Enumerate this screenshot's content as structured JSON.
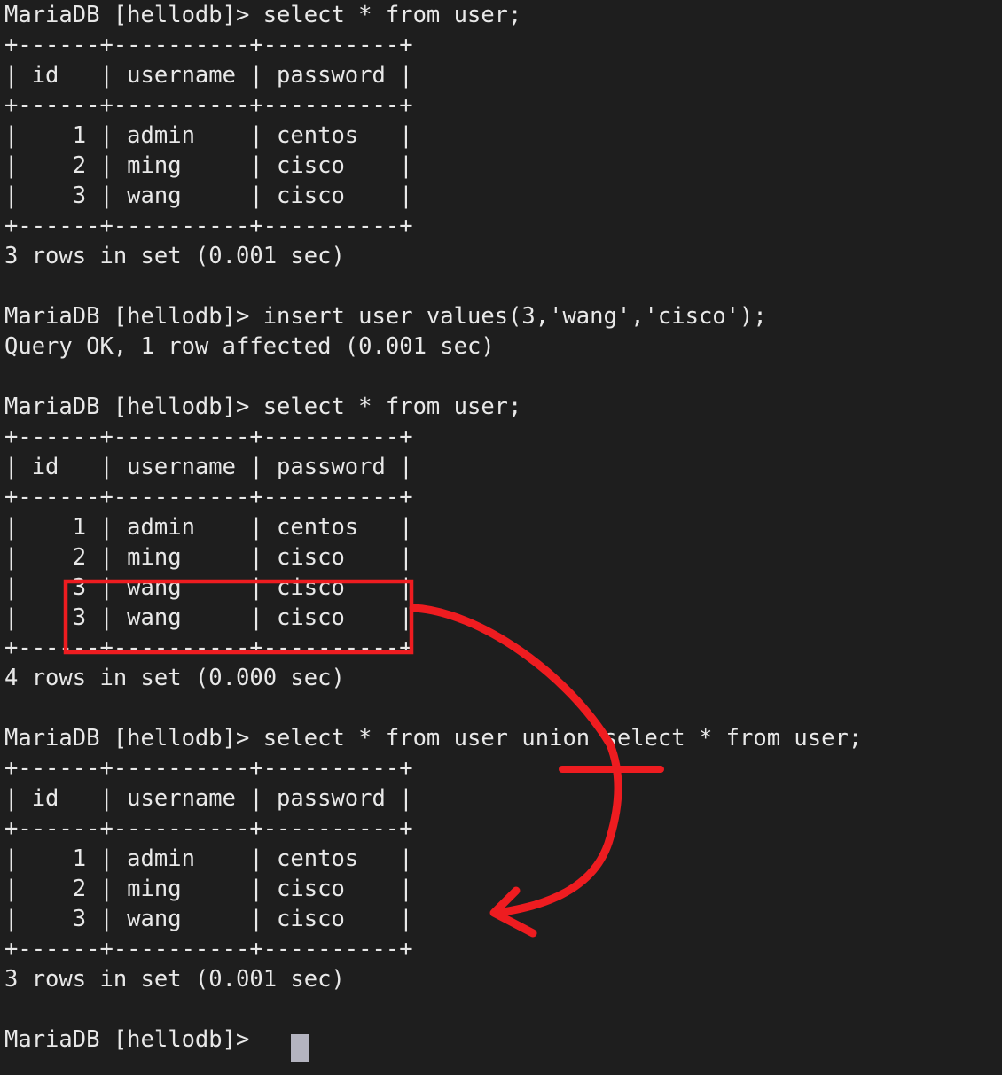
{
  "terminal": {
    "background_color": "#1e1e1e",
    "text_color": "#e8e8e8",
    "annotation_color": "#ee1c20",
    "cursor_color": "#b4b4c0",
    "prompt": "MariaDB [hellodb]>",
    "session_text": "MariaDB [hellodb]> select * from user;\n+------+----------+----------+\n| id   | username | password |\n+------+----------+----------+\n|    1 | admin    | centos   |\n|    2 | ming     | cisco    |\n|    3 | wang     | cisco    |\n+------+----------+----------+\n3 rows in set (0.001 sec)\n\nMariaDB [hellodb]> insert user values(3,'wang','cisco');\nQuery OK, 1 row affected (0.001 sec)\n\nMariaDB [hellodb]> select * from user;\n+------+----------+----------+\n| id   | username | password |\n+------+----------+----------+\n|    1 | admin    | centos   |\n|    2 | ming     | cisco    |\n|    3 | wang     | cisco    |\n|    3 | wang     | cisco    |\n+------+----------+----------+\n4 rows in set (0.000 sec)\n\nMariaDB [hellodb]> select * from user union select * from user;\n+------+----------+----------+\n| id   | username | password |\n+------+----------+----------+\n|    1 | admin    | centos   |\n|    2 | ming     | cisco    |\n|    3 | wang     | cisco    |\n+------+----------+----------+\n3 rows in set (0.001 sec)\n\nMariaDB [hellodb]> ",
    "commands": [
      {
        "prompt": "MariaDB [hellodb]>",
        "command": "select * from user;",
        "result_status": "3 rows in set (0.001 sec)"
      },
      {
        "prompt": "MariaDB [hellodb]>",
        "command": "insert user values(3,'wang','cisco');",
        "result_status": "Query OK, 1 row affected (0.001 sec)"
      },
      {
        "prompt": "MariaDB [hellodb]>",
        "command": "select * from user;",
        "result_status": "4 rows in set (0.000 sec)"
      },
      {
        "prompt": "MariaDB [hellodb]>",
        "command": "select * from user union select * from user;",
        "result_status": "3 rows in set (0.001 sec)"
      }
    ],
    "tables": [
      {
        "columns": [
          "id",
          "username",
          "password"
        ],
        "rows": [
          [
            "1",
            "admin",
            "centos"
          ],
          [
            "2",
            "ming",
            "cisco"
          ],
          [
            "3",
            "wang",
            "cisco"
          ]
        ],
        "row_count_label": "3 rows in set (0.001 sec)"
      },
      {
        "columns": [
          "id",
          "username",
          "password"
        ],
        "rows": [
          [
            "1",
            "admin",
            "centos"
          ],
          [
            "2",
            "ming",
            "cisco"
          ],
          [
            "3",
            "wang",
            "cisco"
          ],
          [
            "3",
            "wang",
            "cisco"
          ]
        ],
        "row_count_label": "4 rows in set (0.000 sec)"
      },
      {
        "columns": [
          "id",
          "username",
          "password"
        ],
        "rows": [
          [
            "1",
            "admin",
            "centos"
          ],
          [
            "2",
            "ming",
            "cisco"
          ],
          [
            "3",
            "wang",
            "cisco"
          ]
        ],
        "row_count_label": "3 rows in set (0.001 sec)"
      }
    ],
    "annotations": {
      "highlight_box_label": "duplicate wang rows highlight",
      "arrow_label": "arrow pointing from duplicate rows to union result",
      "underline_label": "union keyword underline"
    }
  }
}
